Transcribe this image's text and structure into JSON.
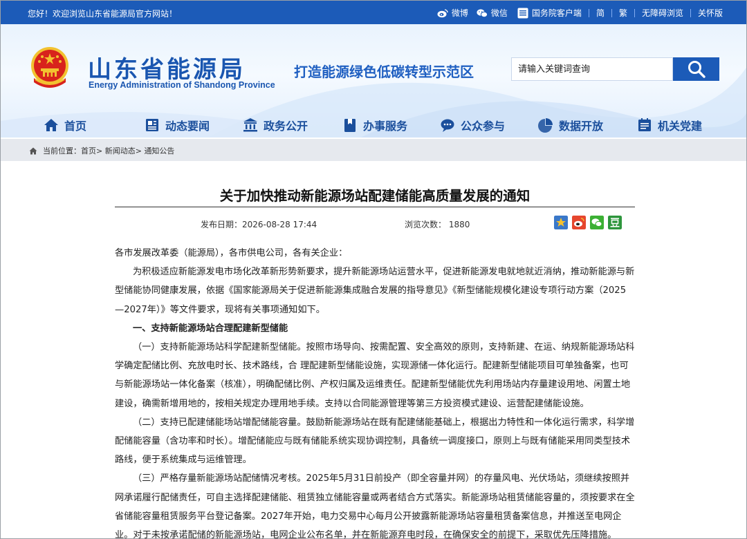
{
  "topbar": {
    "welcome": "您好！欢迎浏览山东省能源局官方网站！",
    "weibo": "微博",
    "wechat": "微信",
    "gov_app": "国务院客户端",
    "simplified": "简",
    "traditional": "繁",
    "accessibility": "无障碍浏览",
    "elder_mode": "关怀版"
  },
  "header": {
    "title": "山东省能源局",
    "subtitle": "Energy Administration of Shandong Province",
    "slogan": "打造能源绿色低碳转型示范区",
    "search_placeholder": "请输入关键词查询"
  },
  "nav": {
    "items": [
      {
        "label": "首页",
        "icon": "home-icon"
      },
      {
        "label": "动态要闻",
        "icon": "news-icon"
      },
      {
        "label": "政务公开",
        "icon": "government-icon"
      },
      {
        "label": "办事服务",
        "icon": "service-icon"
      },
      {
        "label": "公众参与",
        "icon": "chat-icon"
      },
      {
        "label": "数据开放",
        "icon": "data-icon"
      },
      {
        "label": "机关党建",
        "icon": "party-icon"
      }
    ]
  },
  "breadcrumb": {
    "prefix": "当前位置：",
    "items": [
      "首页",
      "新闻动态",
      "通知公告"
    ],
    "sep": ">"
  },
  "article": {
    "title": "关于加快推动新能源场站配建储能高质量发展的通知",
    "date": "发布日期：2026-08-28 17:44",
    "views": "浏览次数： 1880",
    "p0": "各市发展改革委（能源局），各市供电公司，各有关企业：",
    "p1": "为积极适应新能源发电市场化改革新形势新要求，提升新能源场站运营水平，促进新能源发电就地就近消纳，推动新能源与新型储能协同健康发展，依据《国家能源局关于促进新能源集成融合发展的指导意见》《新型储能规模化建设专项行动方案（2025—2027年）》等文件要求，现将有关事项通知如下。",
    "h1": "一、支持新能源场站合理配建新型储能",
    "p2": "（一）支持新能源场站科学配建新型储能。按照市场导向、按需配置、安全高效的原则，支持新建、在运、纳规新能源场站科学确定配储比例、充放电时长、技术路线，合 理配建新型储能设施，实现源储一体化运行。配建新型储能项目可单独备案，也可与新能源场站一体化备案（核准），明确配储比例、产权归属及运维责任。配建新型储能优先利用场站内存量建设用地、闲置土地建设，确需新增用地的，按相关规定办理用地手续。支持以合同能源管理等第三方投资模式建设、运营配建储能设施。",
    "p3": "（二）支持已配建储能场站增配储能容量。鼓励新能源场站在既有配建储能基础上，根据出力特性和一体化运行需求，科学增配储能容量（含功率和时长）。增配储能应与既有储能系统实现协调控制，具备统一调度接口，原则上与既有储能采用同类型技术路线，便于系统集成与运维管理。",
    "p4": "（三）严格存量新能源场站配储情况考核。2025年5月31日前投产（即全容量并网）的存量风电、光伏场站，须继续按照并网承诺履行配储责任，可自主选择配建储能、租赁独立储能容量或两者结合方式落实。新能源场站租赁储能容量的，须按要求在全省储能容量租赁服务平台登记备案。2027年开始，电力交易中心每月公开披露新能源场站容量租赁备案信息，并推送至电网企业。对于未按承诺配储的新能源场站，电网企业公布名单，并在新能源弃电时段，在确保安全的前提下，采取优先压降措施。"
  },
  "colors": {
    "brand_blue": "#1c5bb8",
    "title_blue": "#1a56b0",
    "nav_text": "#1b4f9c",
    "crumb_bg": "#e6e9ee"
  }
}
